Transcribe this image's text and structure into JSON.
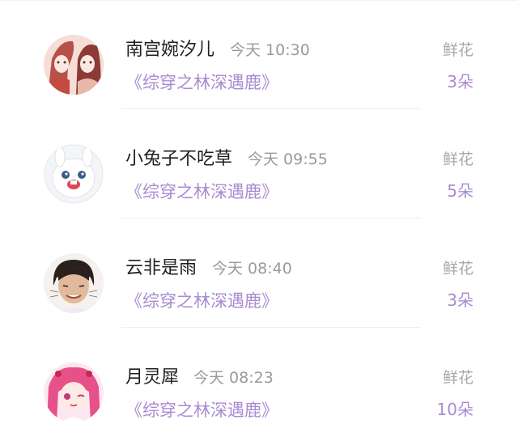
{
  "gifts": [
    {
      "user": "南宫婉汐儿",
      "time": "今天 10:30",
      "book": "《综穿之林深遇鹿》",
      "gift_label": "鲜花",
      "count": "3朵",
      "avatar_icon": "anime-couple-avatar"
    },
    {
      "user": "小兔子不吃草",
      "time": "今天 09:55",
      "book": "《综穿之林深遇鹿》",
      "gift_label": "鲜花",
      "count": "5朵",
      "avatar_icon": "white-bunny-avatar"
    },
    {
      "user": "云非是雨",
      "time": "今天 08:40",
      "book": "《综穿之林深遇鹿》",
      "gift_label": "鲜花",
      "count": "3朵",
      "avatar_icon": "woman-photo-avatar"
    },
    {
      "user": "月灵犀",
      "time": "今天 08:23",
      "book": "《综穿之林深遇鹿》",
      "gift_label": "鲜花",
      "count": "10朵",
      "avatar_icon": "pink-anime-girl-avatar"
    }
  ],
  "colors": {
    "accent": "#a88bd0",
    "muted": "#9a9a9a",
    "text": "#1f1f1f"
  }
}
